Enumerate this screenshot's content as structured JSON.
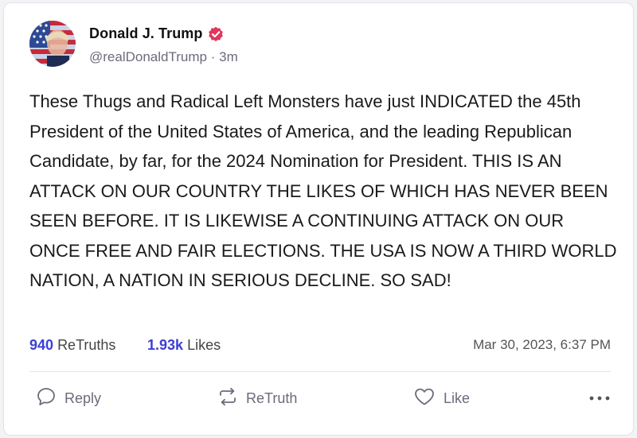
{
  "post": {
    "display_name": "Donald J. Trump",
    "handle": "@realDonaldTrump",
    "separator": "·",
    "time_ago": "3m",
    "text": "These Thugs and Radical Left Monsters have just INDICATED the 45th President of the United States of America, and the leading Republican Candidate, by far, for the 2024 Nomination for President. THIS IS AN ATTACK ON OUR COUNTRY THE LIKES OF WHICH HAS NEVER BEEN SEEN BEFORE. IT IS LIKEWISE A CONTINUING ATTACK ON OUR ONCE FREE AND FAIR ELECTIONS. THE USA IS NOW A THIRD WORLD NATION, A NATION IN SERIOUS DECLINE. SO SAD!"
  },
  "stats": {
    "retruths_count": "940",
    "retruths_label": "ReTruths",
    "likes_count": "1.93k",
    "likes_label": "Likes",
    "timestamp": "Mar 30, 2023, 6:37 PM"
  },
  "actions": {
    "reply_label": "Reply",
    "retruth_label": "ReTruth",
    "like_label": "Like"
  },
  "icons": {
    "avatar": "avatar-flag-portrait",
    "verified": "verified-badge-icon",
    "reply": "speech-bubble-icon",
    "retruth": "repost-arrows-icon",
    "like": "heart-icon",
    "more": "ellipsis-icon"
  },
  "colors": {
    "accent": "#3b3fd6",
    "verified": "#e0385e",
    "muted": "#6b6b7b"
  }
}
